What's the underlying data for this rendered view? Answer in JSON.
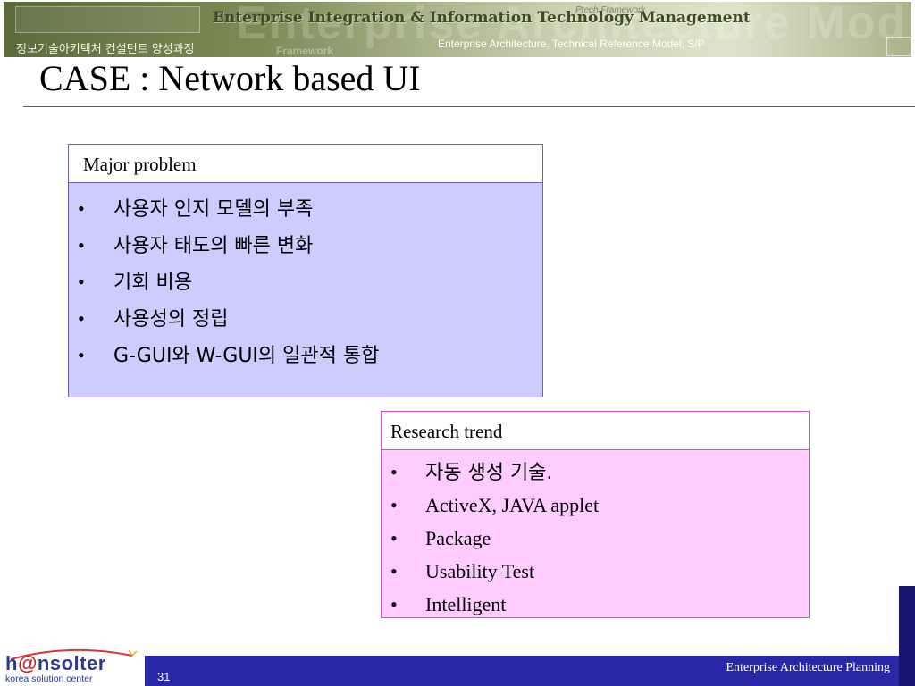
{
  "header": {
    "banner_title": "Enterprise Integration & Information Technology Management",
    "course_name": "정보기술아키텍처 컨설턴트 양성과정",
    "subtitle": "Enterprise Architecture, Technical Reference Model, S/P"
  },
  "slide": {
    "title": "CASE : Network based UI"
  },
  "major_problem": {
    "heading": "Major problem",
    "items": [
      "사용자 인지 모델의 부족",
      "사용자 태도의 빠른 변화",
      "기회 비용",
      "사용성의 정립",
      "G-GUI와 W-GUI의 일관적 통합"
    ]
  },
  "research_trend": {
    "heading": "Research trend",
    "items": [
      "자동 생성 기술.",
      "ActiveX, JAVA applet",
      "Package",
      "Usability Test",
      "Intelligent"
    ]
  },
  "footer": {
    "page_number": "31",
    "label": "Enterprise Architecture Planning",
    "logo_brand_pre": "h",
    "logo_brand_at": "@",
    "logo_brand_post": "nsolter",
    "logo_tagline": "korea solution center"
  },
  "colors": {
    "major_fill": "#ccccff",
    "research_fill": "#ffccff",
    "footer_bar": "#2828a6"
  }
}
